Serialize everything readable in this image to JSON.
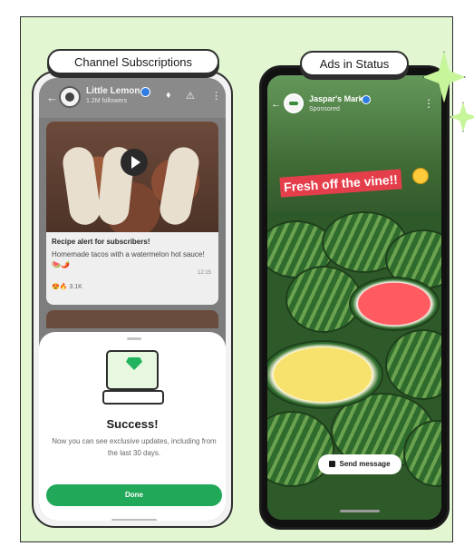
{
  "labels": {
    "left": "Channel Subscriptions",
    "right": "Ads in Status"
  },
  "left_phone": {
    "channel_name": "Little Lemon",
    "followers": "1.2M followers",
    "post": {
      "title": "Recipe alert for subscribers!",
      "body": "Homemade tacos with a watermelon hot sauce! 🍉🌶️",
      "time": "12:15",
      "reactions": "3.1K"
    },
    "sheet": {
      "title": "Success!",
      "text": "Now you can see exclusive updates, including from the last 30 days.",
      "button": "Done"
    }
  },
  "right_phone": {
    "account_name": "Jaspar's Market",
    "account_sub": "Sponsored",
    "caption": "Fresh off the vine!!",
    "send_button": "Send message"
  },
  "colors": {
    "background": "#e2f6d2",
    "accent_green": "#21a859",
    "caption_red": "#e53e4b"
  }
}
